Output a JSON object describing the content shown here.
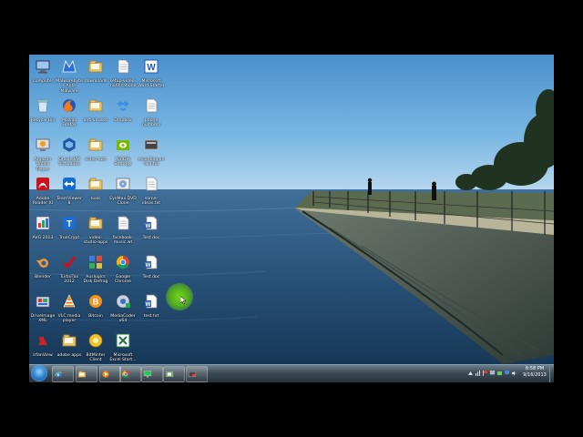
{
  "desktop": {
    "icons": [
      {
        "label": "Computer",
        "icon": "computer-icon"
      },
      {
        "label": "Malwarebytes Anti-Malware",
        "icon": "malwarebytes-icon"
      },
      {
        "label": "downloads",
        "icon": "folder-icon"
      },
      {
        "label": "setup-video-notifications",
        "icon": "document-icon"
      },
      {
        "label": "Microsoft Word Starter",
        "icon": "word-icon"
      },
      {
        "label": "Recycle Bin",
        "icon": "recycle-bin-icon"
      },
      {
        "label": "Mozilla Firefox",
        "icon": "firefox-icon"
      },
      {
        "label": "anti-viruses",
        "icon": "folder-icon"
      },
      {
        "label": "Dropbox",
        "icon": "dropbox-icon"
      },
      {
        "label": "phone numbers",
        "icon": "document-icon"
      },
      {
        "label": "Amazon Unbox Player",
        "icon": "amazon-unbox-icon"
      },
      {
        "label": "Oracle VM VirtualBox",
        "icon": "virtualbox-icon"
      },
      {
        "label": "video tuts",
        "icon": "folder-icon"
      },
      {
        "label": "NVIDIA Settings",
        "icon": "nvidia-icon"
      },
      {
        "label": "recording on dvd.txt",
        "icon": "text-file-icon"
      },
      {
        "label": "Adobe Reader XI",
        "icon": "adobe-reader-icon"
      },
      {
        "label": "TeamViewer 8",
        "icon": "teamviewer-icon"
      },
      {
        "label": "tools",
        "icon": "folder-icon"
      },
      {
        "label": "EyeMax DVD Clone",
        "icon": "dvd-clone-icon"
      },
      {
        "label": "some-ideas.txt",
        "icon": "document-icon"
      },
      {
        "label": "AVG 2013",
        "icon": "avg-icon"
      },
      {
        "label": "TrueCrypt",
        "icon": "truecrypt-icon"
      },
      {
        "label": "video-studio-apps",
        "icon": "folder-icon"
      },
      {
        "label": "facebook-music.wt",
        "icon": "document-icon"
      },
      {
        "label": "Test.doc",
        "icon": "word-doc-icon"
      },
      {
        "label": "Blender",
        "icon": "blender-icon"
      },
      {
        "label": "TurboTax 2012",
        "icon": "turbotax-icon"
      },
      {
        "label": "Auslogics Disk Defrag",
        "icon": "disk-defrag-icon"
      },
      {
        "label": "Google Chrome",
        "icon": "chrome-icon"
      },
      {
        "label": "Test.doc",
        "icon": "word-doc-icon"
      },
      {
        "label": "DriveImage XML",
        "icon": "driveimage-icon"
      },
      {
        "label": "VLC media player",
        "icon": "vlc-icon"
      },
      {
        "label": "Bitcoin",
        "icon": "bitcoin-icon"
      },
      {
        "label": "MediaCoder x64",
        "icon": "mediacoder-icon"
      },
      {
        "label": "test.txt",
        "icon": "word-doc-icon"
      },
      {
        "label": "IrfanView",
        "icon": "irfanview-icon"
      },
      {
        "label": "adobe apps",
        "icon": "folder-icon"
      },
      {
        "label": "BitMinter Client",
        "icon": "bitminter-icon"
      },
      {
        "label": "Microsoft Excel Start...",
        "icon": "excel-icon"
      }
    ]
  },
  "taskbar": {
    "start": "start-orb",
    "pinned": [
      {
        "name": "internet-explorer",
        "icon": "internet-explorer-icon"
      },
      {
        "name": "windows-explorer",
        "icon": "folder-icon"
      },
      {
        "name": "media-player",
        "icon": "media-player-icon"
      },
      {
        "name": "chrome",
        "icon": "chrome-icon"
      },
      {
        "name": "screen-recorder",
        "icon": "monitor-icon"
      },
      {
        "name": "camtasia",
        "icon": "camtasia-icon"
      },
      {
        "name": "capture-tool",
        "icon": "capture-icon"
      }
    ],
    "clock": {
      "time": "8:58 PM",
      "date": "9/16/2013"
    }
  }
}
